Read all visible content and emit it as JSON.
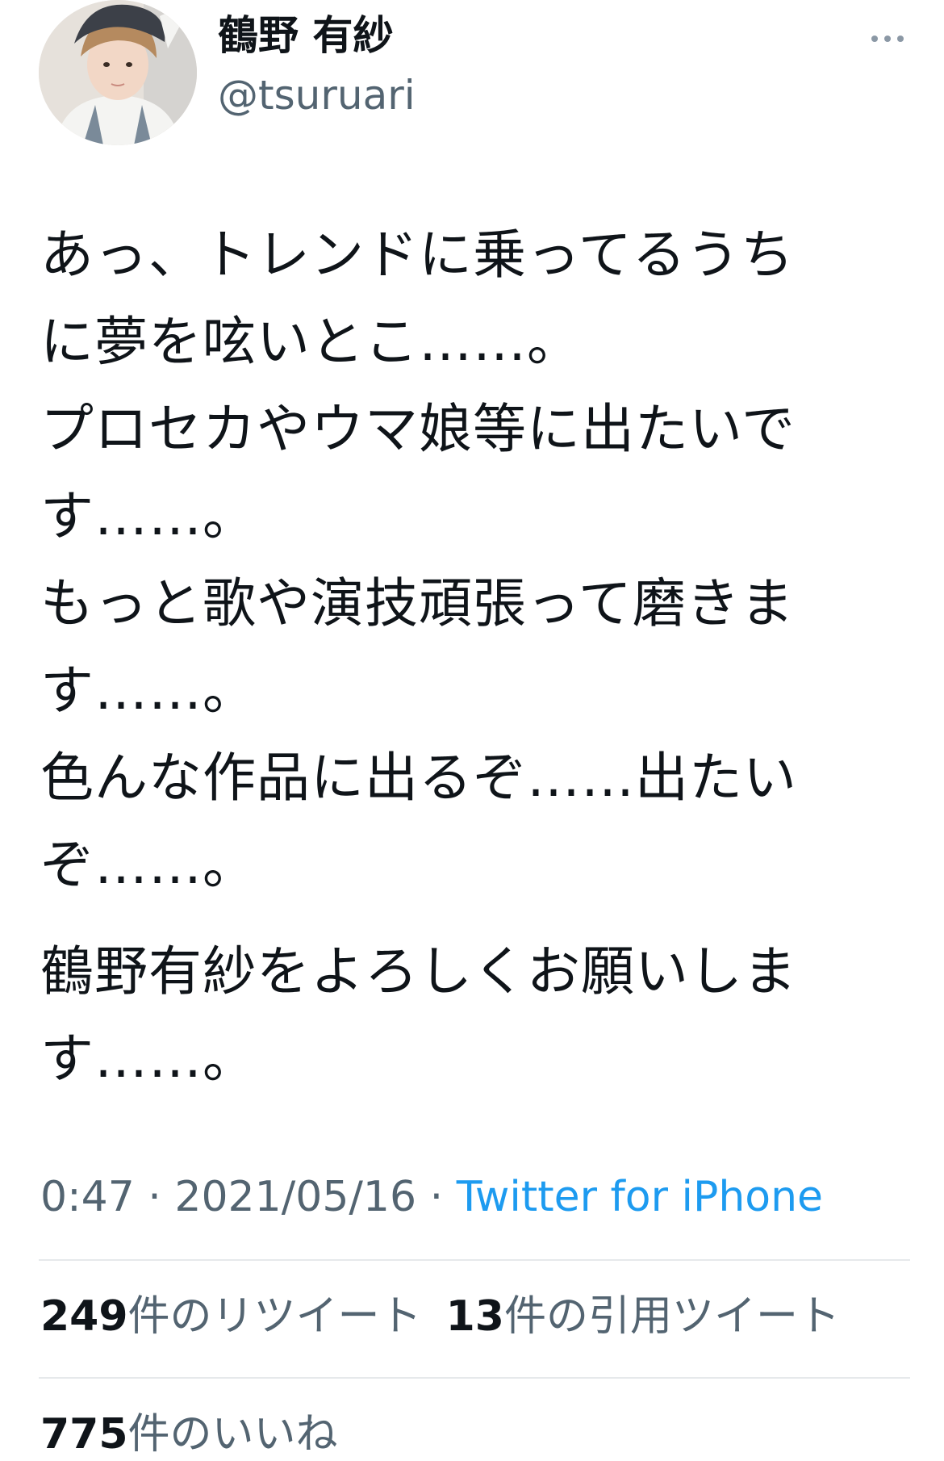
{
  "user": {
    "display_name": "鶴野 有紗",
    "handle": "@tsuruari",
    "avatar_alt": "profile photo"
  },
  "tweet": {
    "lines": [
      "あっ、トレンドに乗ってるうち",
      "に夢を呟いとこ……。",
      "プロセカやウマ娘等に出たいで",
      "す……。",
      "もっと歌や演技頑張って磨きま",
      "す……。",
      "色んな作品に出るぞ……出たい",
      "ぞ……。"
    ],
    "closing_lines": [
      "鶴野有紗をよろしくお願いしま",
      "す……。"
    ],
    "time": "0:47",
    "separator": " · ",
    "date": "2021/05/16",
    "source": "Twitter for iPhone"
  },
  "stats": {
    "retweets_count": "249",
    "retweets_label": "件のリツイート",
    "quotes_count": "13",
    "quotes_label": "件の引用ツイート",
    "likes_count": "775",
    "likes_label": "件のいいね"
  },
  "colors": {
    "text_primary": "#0f1419",
    "text_secondary": "#536471",
    "link": "#1d9bf0",
    "divider": "#e6e9eb"
  },
  "icons": {
    "more": "more-horizontal-icon"
  }
}
